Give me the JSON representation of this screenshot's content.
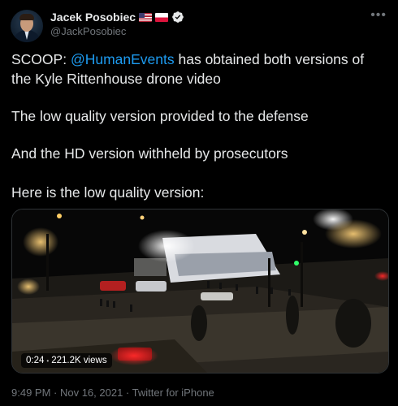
{
  "author": {
    "display_name": "Jacek Posobiec",
    "handle": "@JackPosobiec",
    "flags": [
      "us-flag",
      "poland-flag"
    ],
    "verified": true,
    "verified_color": "#e7e9ea"
  },
  "tweet": {
    "lines": [
      {
        "prefix": "SCOOP: ",
        "mention": "@HumanEvents",
        "suffix": " has obtained both versions of"
      },
      {
        "text": "the Kyle Rittenhouse drone video"
      },
      {
        "text": "The low quality version provided to the defense"
      },
      {
        "text": "And the HD version withheld by prosecutors"
      },
      {
        "text": "Here is the low quality version:"
      }
    ],
    "mention_color": "#1d9bf0"
  },
  "video": {
    "time": "0:24",
    "separator": "•",
    "views": "221.2K views"
  },
  "meta": {
    "timestamp": "9:49 PM · Nov 16, 2021 · Twitter for iPhone"
  },
  "icons": {
    "more": "more-options-icon",
    "verified": "verified-badge-icon"
  }
}
